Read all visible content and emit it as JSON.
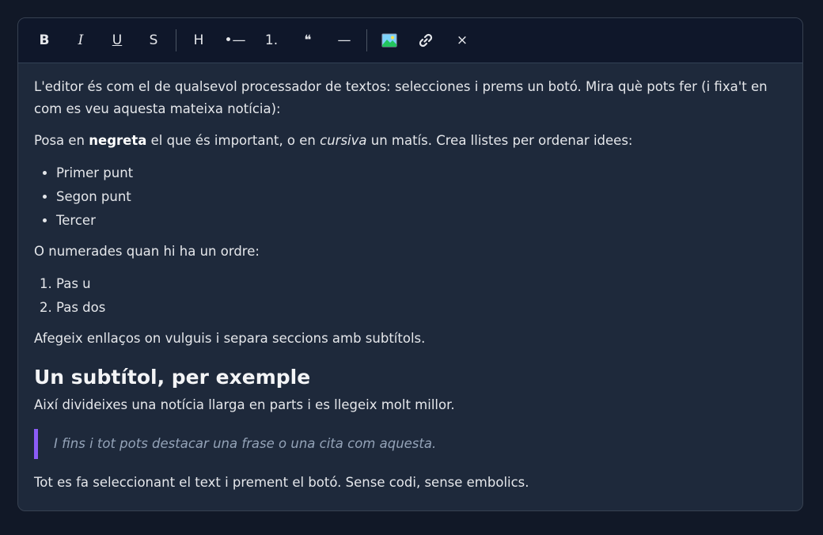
{
  "toolbar": {
    "bold": "B",
    "italic": "I",
    "underline": "U",
    "strike": "S",
    "heading": "H",
    "bullet_list": "•—",
    "ordered_list": "1.",
    "quote": "❝",
    "rule": "—",
    "image": "🖼",
    "link": "🔗",
    "clear": "×"
  },
  "content": {
    "intro": "L'editor és com el de qualsevol processador de textos: selecciones i prems un botó. Mira què pots fer (i fixa't en com es veu aquesta mateixa notícia):",
    "p2_a": "Posa en ",
    "p2_bold": "negreta",
    "p2_b": " el que és important, o en ",
    "p2_italic": "cursiva",
    "p2_c": " un matís. Crea llistes per ordenar idees:",
    "bullets": [
      "Primer punt",
      "Segon punt",
      "Tercer"
    ],
    "p3": "O numerades quan hi ha un ordre:",
    "numbered": [
      "Pas u",
      "Pas dos"
    ],
    "p4": "Afegeix enllaços on vulguis i separa seccions amb subtítols.",
    "subtitle": "Un subtítol, per exemple",
    "p5": "Així divideixes una notícia llarga en parts i es llegeix molt millor.",
    "quote": "I fins i tot pots destacar una frase o una cita com aquesta.",
    "p6": "Tot es fa seleccionant el text i prement el botó. Sense codi, sense embolics."
  },
  "colors": {
    "background": "#111827",
    "editor": "#1e293b",
    "toolbar": "#0f172a",
    "quote_border": "#8b5cf6"
  }
}
